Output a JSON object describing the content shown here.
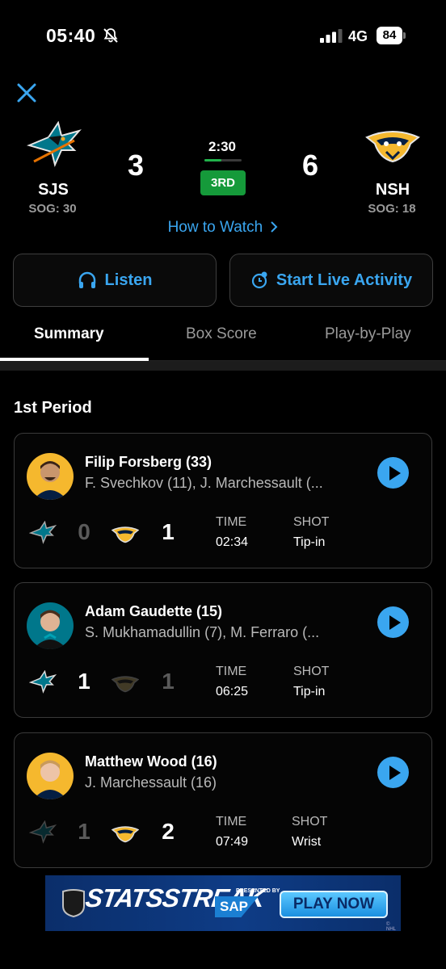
{
  "status_bar": {
    "time": "05:40",
    "network": "4G",
    "battery": "84"
  },
  "game": {
    "away": {
      "abbr": "SJS",
      "sog": "SOG: 30",
      "score": "3"
    },
    "home": {
      "abbr": "NSH",
      "sog": "SOG: 18",
      "score": "6"
    },
    "clock": "2:30",
    "period": "3RD",
    "period_progress": 0.45,
    "how_to_watch": "How to Watch"
  },
  "actions": {
    "listen": "Listen",
    "live_activity": "Start Live Activity"
  },
  "tabs": [
    "Summary",
    "Box Score",
    "Play-by-Play"
  ],
  "active_tab": "Summary",
  "section_title": "1st Period",
  "goals": [
    {
      "scorer": "Filip Forsberg (33)",
      "assists": "F. Svechkov (11), J. Marchessault (...",
      "team": "NSH",
      "away_score": "0",
      "home_score": "1",
      "time_label": "TIME",
      "time": "02:34",
      "shot_label": "SHOT",
      "shot": "Tip-in"
    },
    {
      "scorer": "Adam Gaudette (15)",
      "assists": "S. Mukhamadullin (7), M. Ferraro (...",
      "team": "SJS",
      "away_score": "1",
      "home_score": "1",
      "time_label": "TIME",
      "time": "06:25",
      "shot_label": "SHOT",
      "shot": "Tip-in"
    },
    {
      "scorer": "Matthew Wood (16)",
      "assists": "J. Marchessault (16)",
      "team": "NSH",
      "away_score": "1",
      "home_score": "2",
      "time_label": "TIME",
      "time": "07:49",
      "shot_label": "SHOT",
      "shot": "Wrist"
    }
  ],
  "ad": {
    "brand": "STATSSTREAK",
    "presented_by": "PRESENTED BY",
    "sponsor": "SAP",
    "cta": "PLAY NOW",
    "league_mark": "© NHL"
  },
  "colors": {
    "accent": "#3aa6f0",
    "period_badge": "#159a3a",
    "nsh_gold": "#f5b82e",
    "sjs_teal": "#00778b"
  },
  "icons": [
    "close-icon",
    "headphones-icon",
    "live-activity-icon",
    "chevron-right-icon",
    "play-icon",
    "bell-slash-icon",
    "signal-icon"
  ]
}
